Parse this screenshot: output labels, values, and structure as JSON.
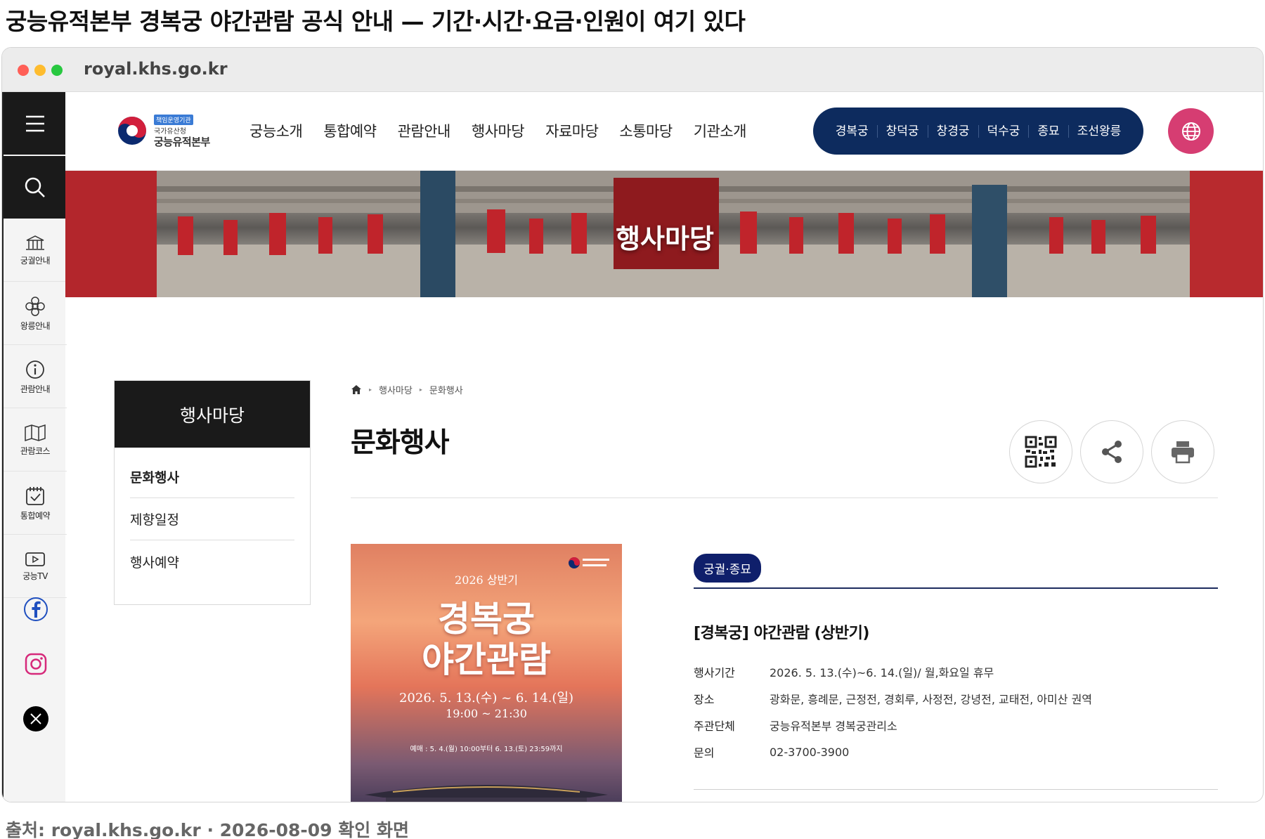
{
  "headline": "궁능유적본부 경복궁 야간관람 공식 안내 — 기간·시간·요금·인원이 여기 있다",
  "caption": "출처: royal.khs.go.kr · 2026-08-09 확인 화면",
  "browser": {
    "url": "royal.khs.go.kr",
    "traffic_lights": [
      "#ff5f57",
      "#febc2e",
      "#28c840"
    ]
  },
  "site": {
    "logo": {
      "tag": "책임운영기관",
      "sub": "국가유산청",
      "main": "궁능유적본부"
    },
    "nav": [
      "궁능소개",
      "통합예약",
      "관람안내",
      "행사마당",
      "자료마당",
      "소통마당",
      "기관소개"
    ],
    "palaces": [
      "경복궁",
      "창덕궁",
      "창경궁",
      "덕수궁",
      "종묘",
      "조선왕릉"
    ],
    "colors": {
      "navy": "#0d2b5e",
      "globe": "#d63d72",
      "badge": "#0f1f6b"
    }
  },
  "rail": {
    "menu_icon": "hamburger-icon",
    "search_icon": "search-icon",
    "items": [
      {
        "label": "궁궐안내",
        "icon": "palace-icon"
      },
      {
        "label": "왕릉안내",
        "icon": "flower-icon"
      },
      {
        "label": "관람안내",
        "icon": "info-icon"
      },
      {
        "label": "관람코스",
        "icon": "map-icon"
      },
      {
        "label": "통합예약",
        "icon": "calendar-check-icon"
      },
      {
        "label": "궁능TV",
        "icon": "play-icon"
      }
    ],
    "social": [
      "facebook-icon",
      "instagram-icon",
      "x-icon"
    ]
  },
  "banner": {
    "title": "행사마당"
  },
  "sidenav": {
    "title": "행사마당",
    "items": [
      {
        "label": "문화행사",
        "active": true
      },
      {
        "label": "제향일정",
        "active": false
      },
      {
        "label": "행사예약",
        "active": false
      }
    ]
  },
  "breadcrumb": {
    "home_icon": "home-icon",
    "items": [
      "행사마당",
      "문화행사"
    ]
  },
  "page_title": "문화행사",
  "tools": [
    "qr-code-icon",
    "share-icon",
    "print-icon"
  ],
  "poster": {
    "season": "2026 상반기",
    "title_line1": "경복궁",
    "title_line2": "야간관람",
    "dates": "2026. 5. 13.(수) ~ 6. 14.(일)",
    "time": "19:00 ~ 21:30",
    "note": "예매 : 5. 4.(월) 10:00부터 6. 13.(토) 23:59까지"
  },
  "event": {
    "badge": "궁궐·종묘",
    "title": "[경복궁] 야간관람 (상반기)",
    "info": [
      {
        "key": "행사기간",
        "value": "2026. 5. 13.(수)~6. 14.(일)/ 월,화요일 휴무"
      },
      {
        "key": "장소",
        "value": "광화문, 흥례문, 근정전, 경회루, 사정전, 강녕전, 교태전, 아미산 권역"
      },
      {
        "key": "주관단체",
        "value": "궁능유적본부 경복궁관리소"
      },
      {
        "key": "문의",
        "value": "02-3700-3900"
      }
    ]
  }
}
